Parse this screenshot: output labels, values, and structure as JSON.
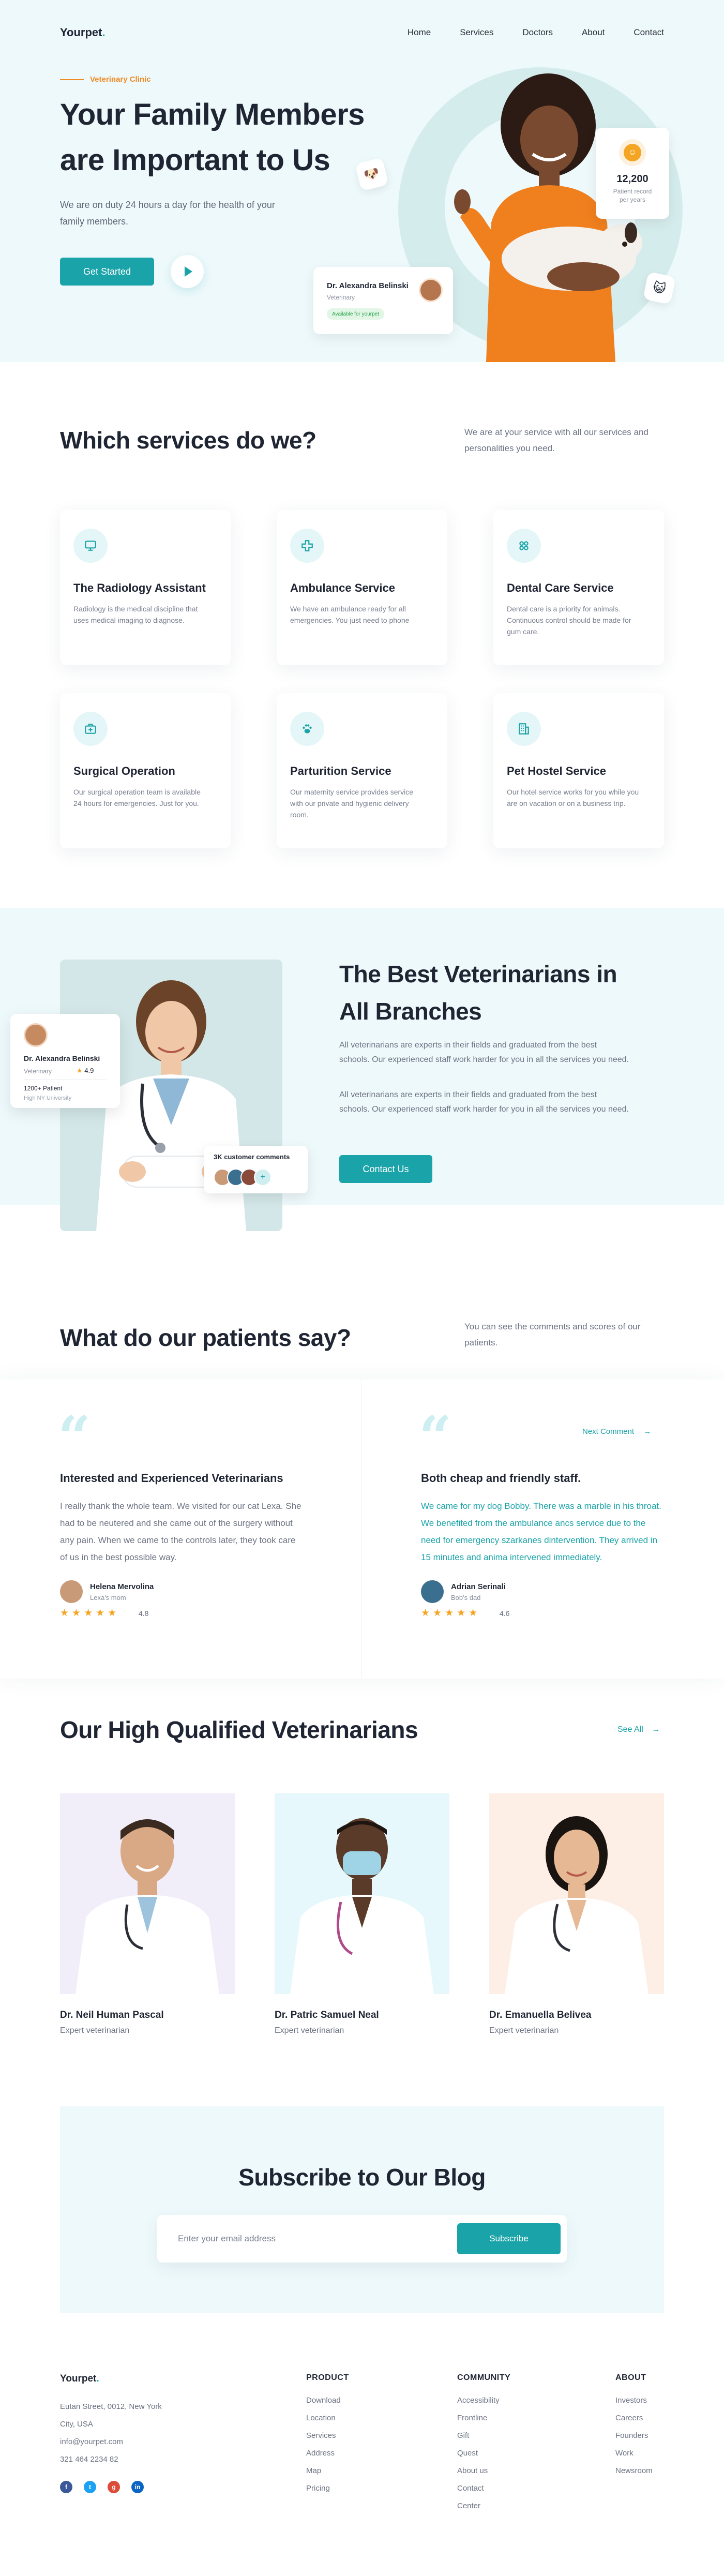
{
  "nav": {
    "logo": "Yourpet",
    "logo_dot": ".",
    "links": [
      "Home",
      "Services",
      "Doctors",
      "About",
      "Contact"
    ]
  },
  "hero": {
    "eyebrow": "Veterinary Clinic",
    "title": "Your Family Members are Important to Us",
    "description": "We are on duty 24 hours a day for the health of your family members.",
    "cta": "Get Started",
    "patient_number": "12,200",
    "patient_label": "Patient record per years",
    "doctor_name": "Dr. Alexandra Belinski",
    "doctor_role": "Veterinary",
    "doctor_status": "Available for yourpet"
  },
  "services": {
    "title": "Which services do we?",
    "description": "We are at your service with all our services and personalities you need.",
    "items": [
      {
        "title": "The Radiology Assistant",
        "text": "Radiology is the medical discipline that uses medical imaging to diagnose.",
        "icon": "monitor-icon"
      },
      {
        "title": "Ambulance Service",
        "text": "We have an ambulance ready for all emergencies. You just need to phone",
        "icon": "medical-cross-icon"
      },
      {
        "title": "Dental Care Service",
        "text": "Dental care is a priority for animals. Continuous control should be made for gum care.",
        "icon": "dental-icon"
      },
      {
        "title": "Surgical Operation",
        "text": "Our surgical operation team is available 24 hours for emergencies. Just for you.",
        "icon": "medical-bag-icon"
      },
      {
        "title": "Parturition Service",
        "text": "Our maternity service provides service with our private and hygienic delivery room.",
        "icon": "paw-icon"
      },
      {
        "title": "Pet Hostel Service",
        "text": "Our hotel service works for you while you are on vacation or on a business trip.",
        "icon": "building-icon"
      }
    ]
  },
  "best": {
    "title": "The Best Veterinarians in All Branches",
    "paragraph1": "All veterinarians are experts in their fields and graduated from the best schools. Our experienced staff work harder for you in all the services you need.",
    "paragraph2": "All veterinarians are experts in their fields and graduated from the best schools. Our experienced staff work harder for you in all the services you need.",
    "cta": "Contact Us",
    "card_name": "Dr. Alexandra Belinski",
    "card_role": "Veterinary",
    "card_rating": "4.9",
    "card_patients": "1200+ Patient",
    "card_university": "High NY University",
    "customers_title": "3K customer comments",
    "customers_more": "+"
  },
  "testimonials": {
    "title": "What do our patients say?",
    "description": "You can see the comments and scores of our patients.",
    "next_label": "Next Comment",
    "items": [
      {
        "title": "Interested and Experienced Veterinarians",
        "text": "I really thank the whole team. We visited for our cat Lexa. She had to be neutered and she came out of the surgery without any pain. When we came to the controls later, they took care of us in the best possible way.",
        "name": "Helena Mervolina",
        "role": "Lexa's mom",
        "stars": "★★★★★",
        "score": "4.8"
      },
      {
        "title": "Both cheap and friendly staff.",
        "text": "We came for my dog Bobby. There was a marble in his throat. We benefited from the ambulance ancs service due to the need for emergency szarkanes dintervention. They arrived in 15 minutes and anima intervened immediately.",
        "name": "Adrian Serinali",
        "role": "Bob's dad",
        "stars": "★★★★★",
        "score": "4.6"
      }
    ]
  },
  "team": {
    "title": "Our High Qualified Veterinarians",
    "see_all": "See All",
    "members": [
      {
        "name": "Dr. Neil Human Pascal",
        "role": "Expert veterinarian"
      },
      {
        "name": "Dr. Patric Samuel Neal",
        "role": "Expert veterinarian"
      },
      {
        "name": "Dr. Emanuella Belivea",
        "role": "Expert veterinarian"
      }
    ]
  },
  "subscribe": {
    "title": "Subscribe to Our Blog",
    "placeholder": "Enter your email address",
    "button": "Subscribe"
  },
  "footer": {
    "logo": "Yourpet",
    "address_lines": [
      "Eutan Street, 0012, New York",
      "City, USA",
      "info@yourpet.com",
      "321 464 2234 82"
    ],
    "columns": [
      {
        "title": "PRODUCT",
        "items": [
          "Download",
          "Location",
          "Services",
          "Address",
          "Map",
          "Pricing"
        ]
      },
      {
        "title": "COMMUNITY",
        "items": [
          "Accessibility",
          "Frontline",
          "Gift",
          "Quest",
          "About us",
          "Contact",
          "Center"
        ]
      },
      {
        "title": "ABOUT",
        "items": [
          "Investors",
          "Careers",
          "Founders",
          "Work",
          "Newsroom"
        ]
      }
    ],
    "socials": [
      {
        "icon": "facebook-icon",
        "glyph": "f",
        "color": "#3b5998"
      },
      {
        "icon": "twitter-icon",
        "glyph": "t",
        "color": "#1da1f2"
      },
      {
        "icon": "google-plus-icon",
        "glyph": "g",
        "color": "#dd4b39"
      },
      {
        "icon": "linkedin-icon",
        "glyph": "in",
        "color": "#0a66c2"
      }
    ]
  },
  "colors": {
    "accent": "#1aa3a8",
    "accent_light": "#eef9fb",
    "orange": "#f08a24",
    "star": "#f5a524"
  }
}
